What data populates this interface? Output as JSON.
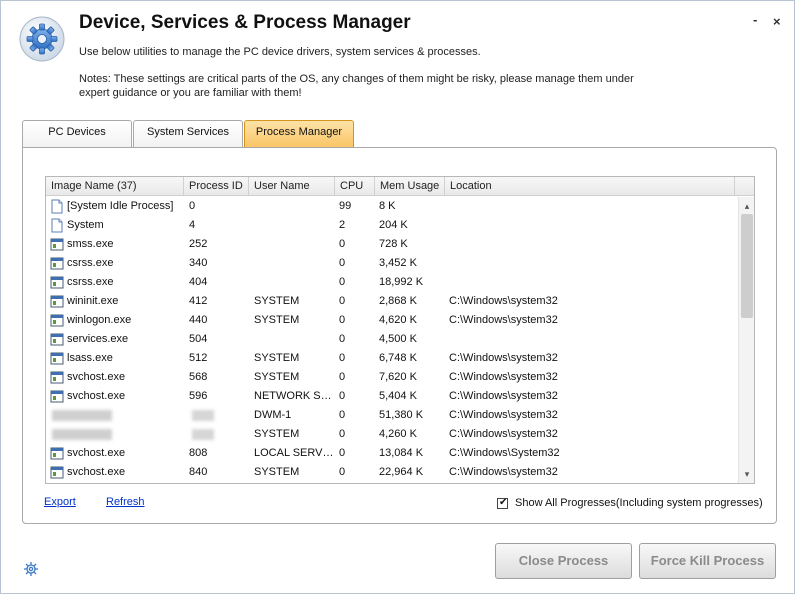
{
  "window": {
    "title": "Device, Services & Process Manager",
    "subtitle": "Use below utilities to manage the PC device drivers, system services & processes.",
    "notes": "Notes: These settings are critical parts of the OS, any changes of them might be risky, please manage them under expert guidance or you are familiar with them!",
    "minimize": "‑",
    "close": "×"
  },
  "tabs": [
    {
      "label": "PC Devices",
      "active": false
    },
    {
      "label": "System Services",
      "active": false
    },
    {
      "label": "Process Manager",
      "active": true
    }
  ],
  "table": {
    "columns": [
      "Image Name  (37)",
      "Process ID",
      "User Name",
      "CPU",
      "Mem Usage",
      "Location"
    ],
    "rows": [
      {
        "name": "[System Idle Process]",
        "pid": "0",
        "user": "",
        "cpu": "99",
        "mem": "8 K",
        "loc": "",
        "icon": "document-icon"
      },
      {
        "name": "System",
        "pid": "4",
        "user": "",
        "cpu": "2",
        "mem": "204 K",
        "loc": "",
        "icon": "document-icon"
      },
      {
        "name": "smss.exe",
        "pid": "252",
        "user": "",
        "cpu": "0",
        "mem": "728 K",
        "loc": "",
        "icon": "app-window-icon"
      },
      {
        "name": "csrss.exe",
        "pid": "340",
        "user": "",
        "cpu": "0",
        "mem": "3,452 K",
        "loc": "",
        "icon": "app-window-icon"
      },
      {
        "name": "csrss.exe",
        "pid": "404",
        "user": "",
        "cpu": "0",
        "mem": "18,992 K",
        "loc": "",
        "icon": "app-window-icon"
      },
      {
        "name": "wininit.exe",
        "pid": "412",
        "user": "SYSTEM",
        "cpu": "0",
        "mem": "2,868 K",
        "loc": "C:\\Windows\\system32",
        "icon": "app-window-icon"
      },
      {
        "name": "winlogon.exe",
        "pid": "440",
        "user": "SYSTEM",
        "cpu": "0",
        "mem": "4,620 K",
        "loc": "C:\\Windows\\system32",
        "icon": "app-window-icon"
      },
      {
        "name": "services.exe",
        "pid": "504",
        "user": "",
        "cpu": "0",
        "mem": "4,500 K",
        "loc": "",
        "icon": "app-window-icon"
      },
      {
        "name": "lsass.exe",
        "pid": "512",
        "user": "SYSTEM",
        "cpu": "0",
        "mem": "6,748 K",
        "loc": "C:\\Windows\\system32",
        "icon": "app-window-icon"
      },
      {
        "name": "svchost.exe",
        "pid": "568",
        "user": "SYSTEM",
        "cpu": "0",
        "mem": "7,620 K",
        "loc": "C:\\Windows\\system32",
        "icon": "app-window-icon"
      },
      {
        "name": "svchost.exe",
        "pid": "596",
        "user": "NETWORK SE...",
        "cpu": "0",
        "mem": "5,404 K",
        "loc": "C:\\Windows\\system32",
        "icon": "app-window-icon"
      },
      {
        "name": "",
        "pid": "",
        "user": "DWM-1",
        "cpu": "0",
        "mem": "51,380 K",
        "loc": "C:\\Windows\\system32",
        "icon": "",
        "blurred": true
      },
      {
        "name": "",
        "pid": "",
        "user": "SYSTEM",
        "cpu": "0",
        "mem": "4,260 K",
        "loc": "C:\\Windows\\system32",
        "icon": "",
        "blurred": true
      },
      {
        "name": "svchost.exe",
        "pid": "808",
        "user": "LOCAL SERVICE",
        "cpu": "0",
        "mem": "13,084 K",
        "loc": "C:\\Windows\\System32",
        "icon": "app-window-icon"
      },
      {
        "name": "svchost.exe",
        "pid": "840",
        "user": "SYSTEM",
        "cpu": "0",
        "mem": "22,964 K",
        "loc": "C:\\Windows\\system32",
        "icon": "app-window-icon"
      }
    ]
  },
  "scrollbar": {
    "up": "▴",
    "down": "▾"
  },
  "links": {
    "export": "Export",
    "refresh": "Refresh"
  },
  "options": {
    "show_all_label": "Show All Progresses(Including system progresses)",
    "show_all_checked": true,
    "check_glyph": "✔"
  },
  "buttons": {
    "close_process": "Close Process",
    "force_kill": "Force Kill Process"
  },
  "colors": {
    "active_tab": "#f9c463",
    "link": "#0033cc",
    "disabled_text": "#8a8a8a"
  }
}
